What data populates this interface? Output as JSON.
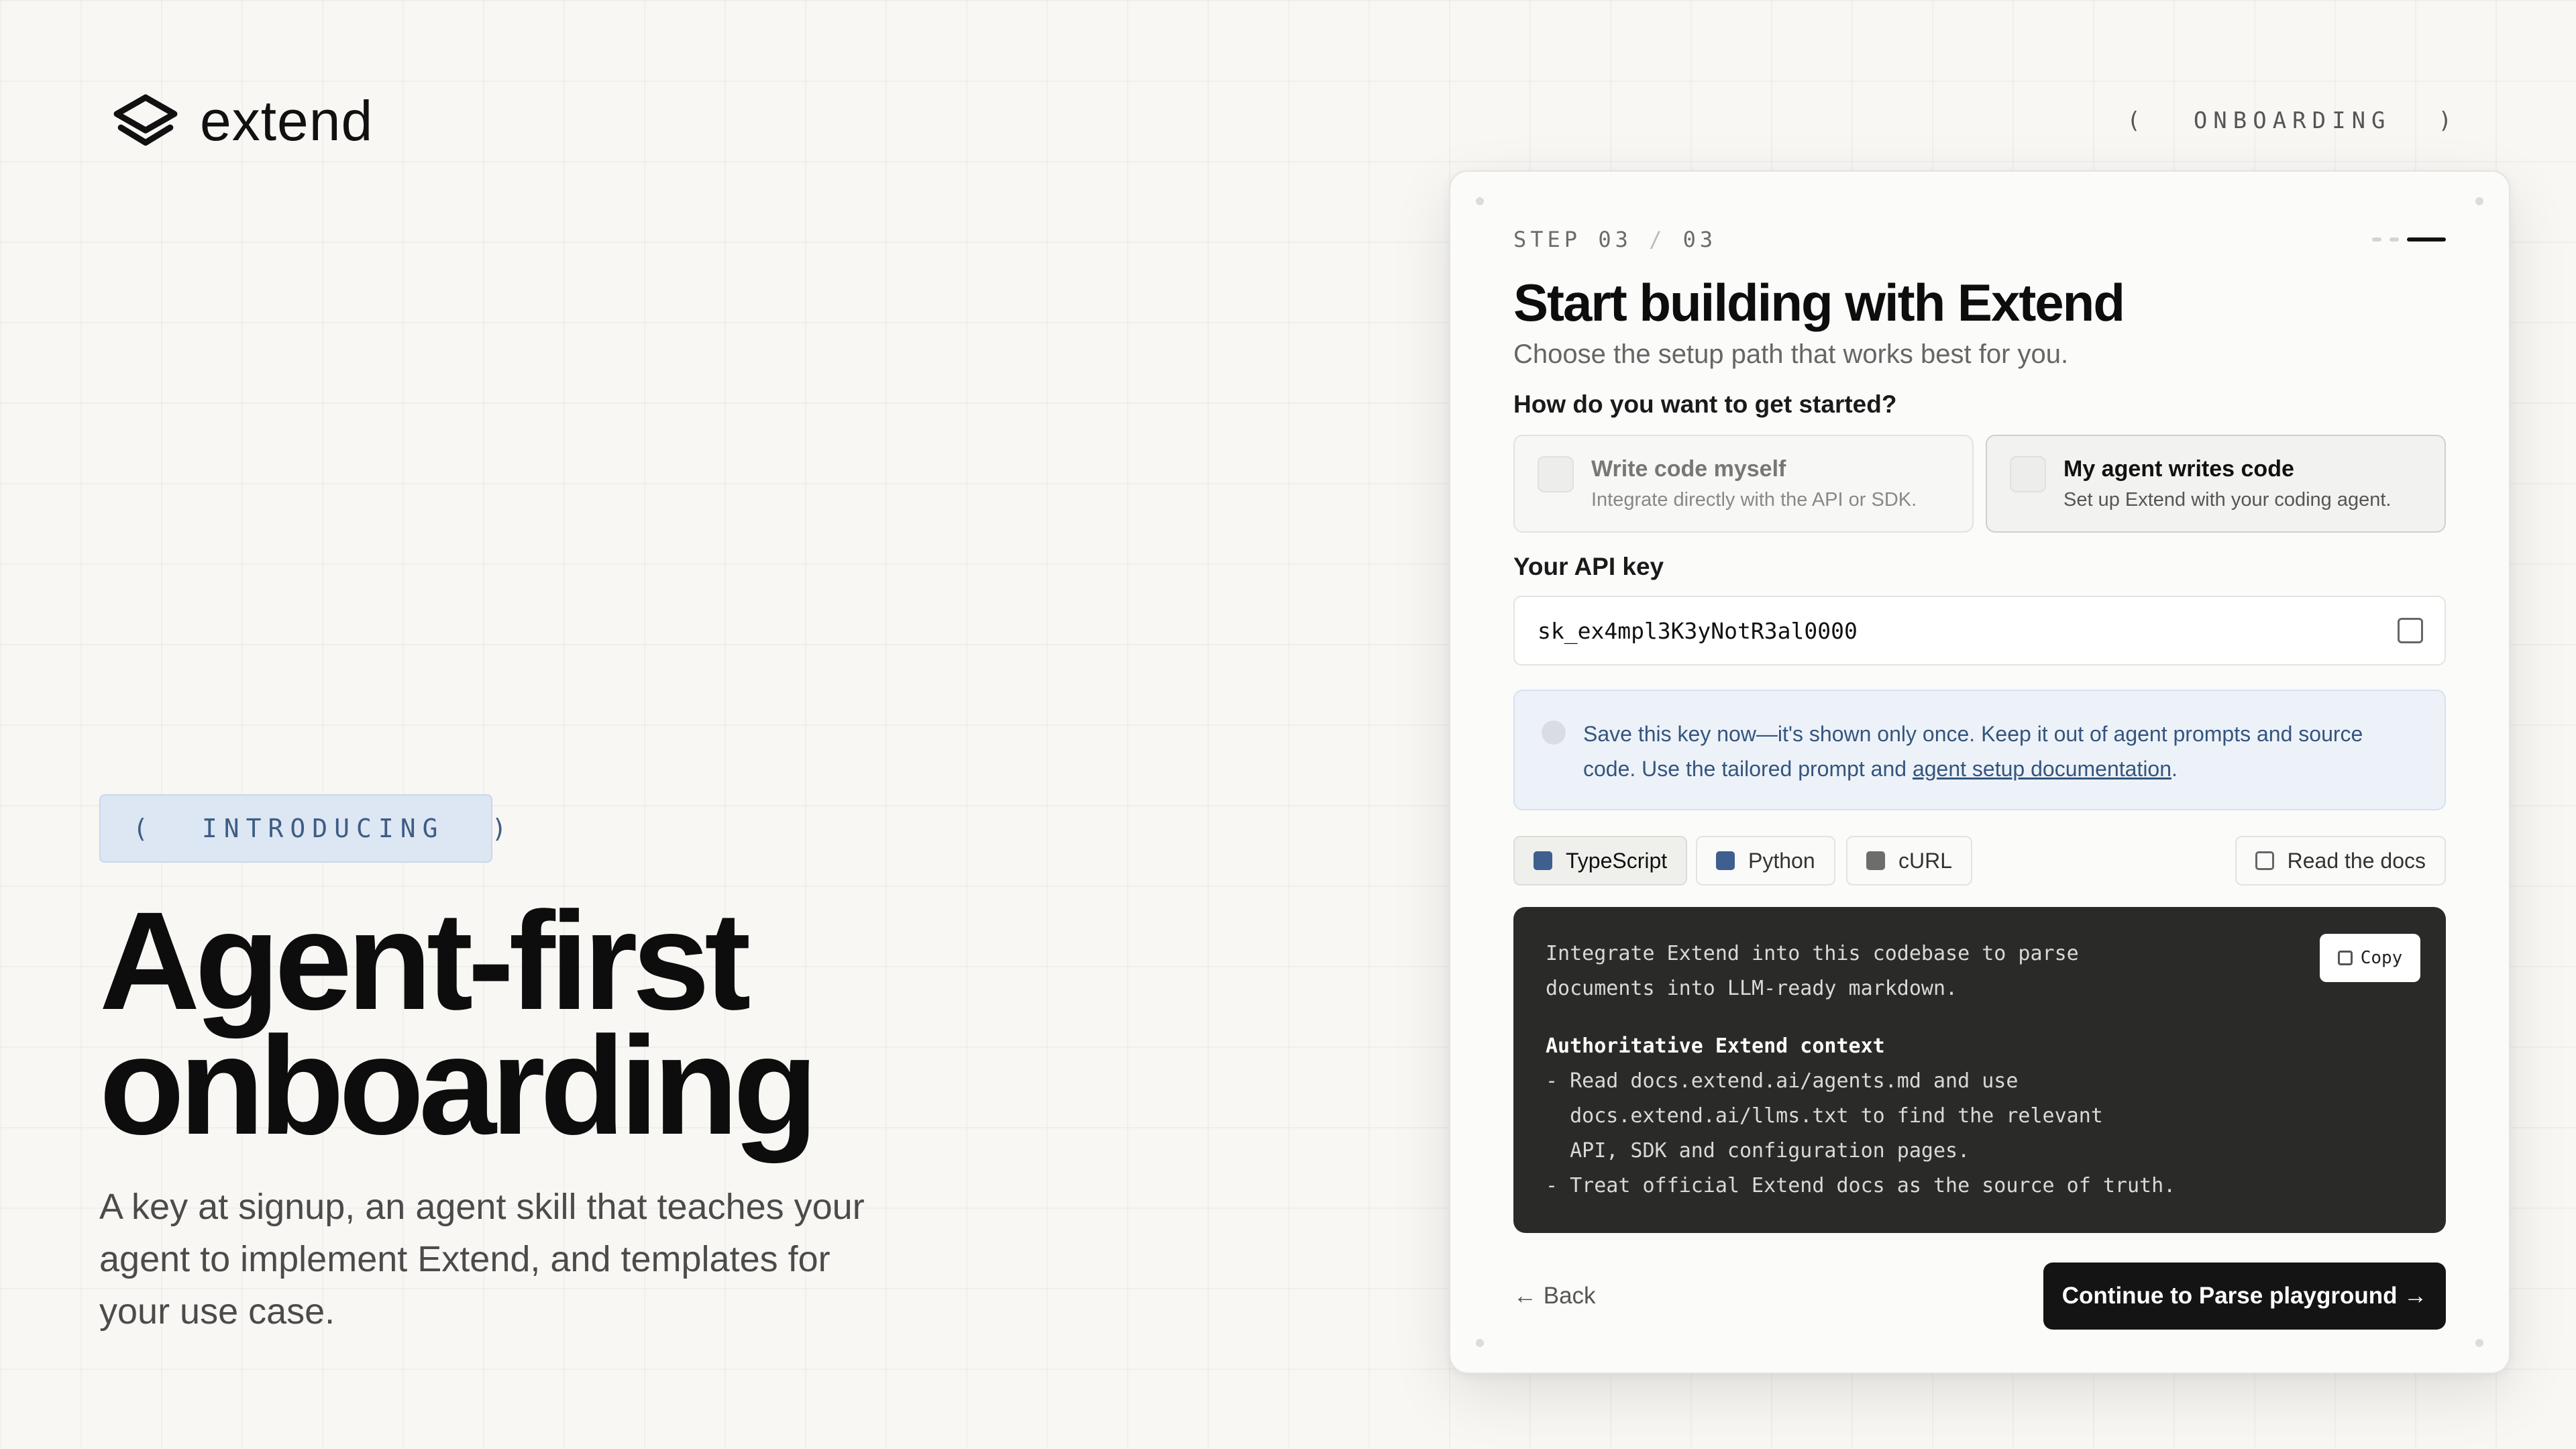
{
  "brand": {
    "name": "extend",
    "logo_icon": "stacked-layers-icon"
  },
  "top_tag": {
    "open": "(",
    "label": "ONBOARDING",
    "close": ")"
  },
  "hero": {
    "pill": {
      "open": "(",
      "label": "INTRODUCING",
      "close": ")"
    },
    "title_line1": "Agent-first",
    "title_line2": "onboarding",
    "subtitle": "A key at signup, an agent skill that teaches your agent to implement Extend, and templates for your use case."
  },
  "card": {
    "step_prefix": "STEP",
    "step_current": "03",
    "step_sep": "/",
    "step_total": "03",
    "progress": {
      "current": 3,
      "total": 3
    },
    "title": "Start building with Extend",
    "subtitle": "Choose the setup path that works best for you.",
    "question": "How do you want to get started?",
    "options": [
      {
        "title": "Write code myself",
        "desc": "Integrate directly with the API or SDK.",
        "selected": false
      },
      {
        "title": "My agent writes code",
        "desc": "Set up Extend with your coding agent.",
        "selected": true
      }
    ],
    "api_key_label": "Your API key",
    "api_key_value": "sk_ex4mpl3K3yNotR3al0000",
    "notice": {
      "text": "Save this key now—it's shown only once. Keep it out of agent prompts and source code. Use the tailored prompt and ",
      "link": "agent setup documentation",
      "end": "."
    },
    "languages": [
      {
        "label": "TypeScript",
        "color": "#3e5f8f",
        "active": true
      },
      {
        "label": "Python",
        "color": "#3e5f8f",
        "active": false
      },
      {
        "label": "cURL",
        "color": "#6d6d6b",
        "active": false
      }
    ],
    "docs_button": "Read the docs",
    "code": {
      "line1": "Integrate Extend into this codebase to parse",
      "line2": "documents into LLM-ready markdown.",
      "line3": "Authoritative Extend context",
      "line4": "- Read docs.extend.ai/agents.md and use",
      "line5": "  docs.extend.ai/llms.txt to find the relevant",
      "line6": "  API, SDK and configuration pages.",
      "line7": "- Treat official Extend docs as the source of truth.",
      "copy_label": "Copy"
    },
    "back_label": "← Back",
    "continue_label": "Continue to Parse playground →"
  }
}
